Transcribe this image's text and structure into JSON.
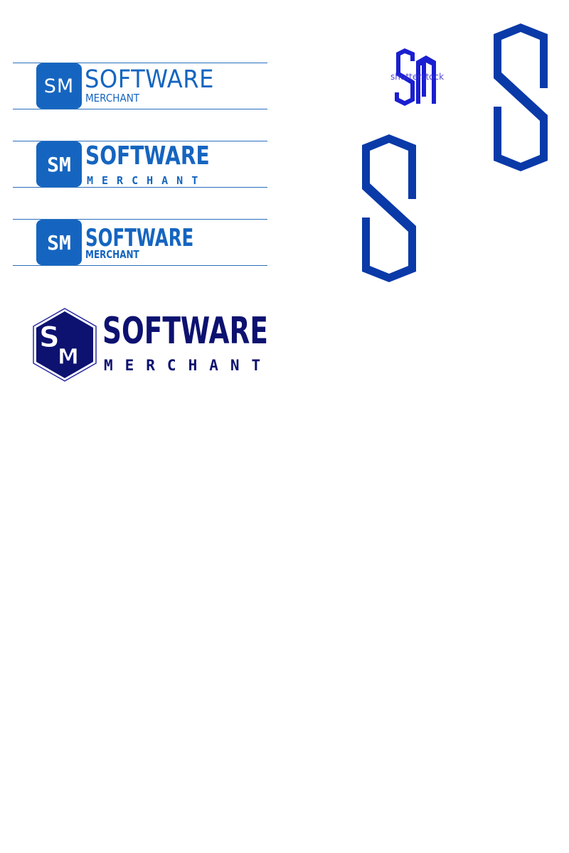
{
  "brand": {
    "monogram": "SM",
    "name": "SOFTWARE",
    "tagline": "MERCHANT"
  },
  "watermark": "shutterstock",
  "colors": {
    "primary_blue": "#1565c0",
    "guide_line": "#2a6fbd",
    "navy": "#0d1270",
    "royal_blue": "#0a3aa8",
    "mark_blue": "#1a1fd0"
  },
  "icons": [
    "hexagon-sm-emblem-icon",
    "sm-monogram-icon",
    "s-letter-outline-icon"
  ]
}
